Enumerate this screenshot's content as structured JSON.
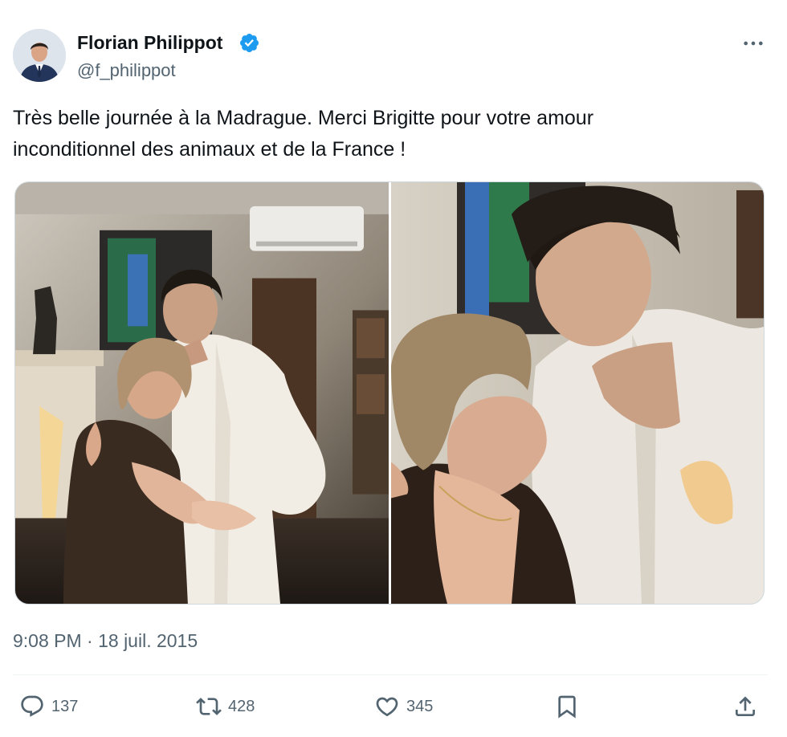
{
  "author": {
    "name": "Florian Philippot",
    "handle": "@f_philippot",
    "verified": true
  },
  "tweet": {
    "text_line_1": "Très belle journée à la Madrague. Merci Brigitte pour votre amour",
    "text_line_2": "inconditionnel des animaux et de la France !",
    "timestamp": "9:08 PM · 18 juil. 2015"
  },
  "media": {
    "count": 2
  },
  "actions": {
    "replies": "137",
    "retweets": "428",
    "likes": "345"
  },
  "icons": {
    "more": "more-horizontal-icon",
    "reply": "reply-icon",
    "retweet": "retweet-icon",
    "like": "heart-icon",
    "bookmark": "bookmark-icon",
    "share": "share-icon",
    "verified": "verified-badge-icon"
  },
  "colors": {
    "text": "#0f1419",
    "secondary": "#536471",
    "verified": "#1d9bf0",
    "border": "#cfd9de"
  }
}
